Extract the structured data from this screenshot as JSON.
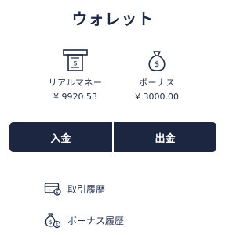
{
  "header": {
    "title": "ウォレット"
  },
  "balances": {
    "real": {
      "label": "リアルマネー",
      "value": "¥ 9920.53",
      "icon": "atm-dollar-icon"
    },
    "bonus": {
      "label": "ボーナス",
      "value": "¥ 3000.00",
      "icon": "money-bag-icon"
    }
  },
  "actions": {
    "deposit_label": "入金",
    "withdraw_label": "出金"
  },
  "menu": {
    "items": [
      {
        "label": "取引履歴",
        "icon": "credit-card-icon"
      },
      {
        "label": "ボーナス履歴",
        "icon": "money-bags-icon"
      }
    ]
  },
  "colors": {
    "primary": "#1c2641",
    "text": "#1e2a44"
  }
}
